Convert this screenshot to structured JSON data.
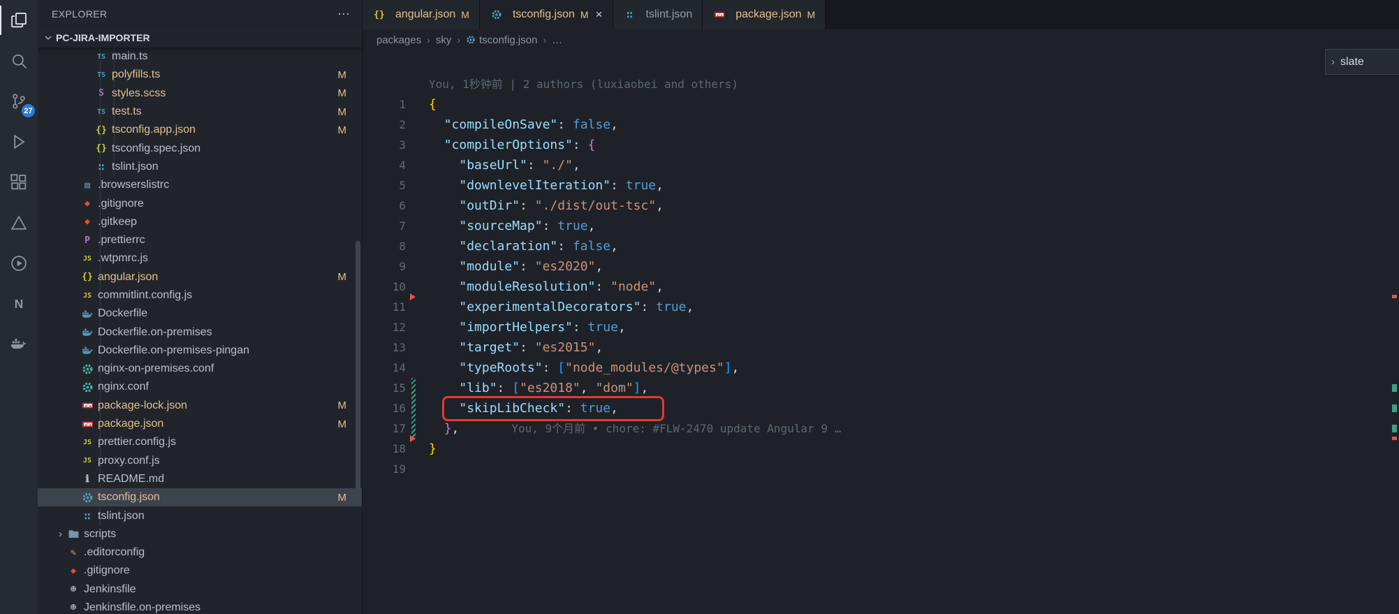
{
  "colors": {
    "git_modified": "#e2c08d",
    "annotation_red": "#e5392e",
    "badge_blue": "#2c7bd6",
    "modified_gutter": "#3ba183",
    "deleted_gutter": "#e5534b"
  },
  "activity_bar": {
    "items": [
      {
        "icon": "files-icon",
        "name": "explorer",
        "active": true
      },
      {
        "icon": "search-icon",
        "name": "search"
      },
      {
        "icon": "source-control-icon",
        "name": "source-control",
        "badge": "27"
      },
      {
        "icon": "run-debug-icon",
        "name": "run-debug"
      },
      {
        "icon": "extensions-icon",
        "name": "extensions"
      },
      {
        "icon": "triangle-extension-icon",
        "name": "triangle-extension"
      },
      {
        "icon": "play-circle-icon",
        "name": "play-circle-extension"
      },
      {
        "icon": "nx-icon",
        "name": "nx-console"
      },
      {
        "icon": "docker-icon",
        "name": "docker-extension"
      }
    ]
  },
  "sidebar": {
    "title": "EXPLORER",
    "more_label": "⋯",
    "section": "PC-JIRA-IMPORTER",
    "git_modified_label": "M",
    "tree": [
      {
        "label": "main.ts",
        "icon": "typescript",
        "level": 3
      },
      {
        "label": "polyfills.ts",
        "icon": "typescript",
        "level": 3,
        "modified": true
      },
      {
        "label": "styles.scss",
        "icon": "sass",
        "level": 3,
        "modified": true
      },
      {
        "label": "test.ts",
        "icon": "typescript",
        "level": 3,
        "modified": true
      },
      {
        "label": "tsconfig.app.json",
        "icon": "json",
        "level": 3,
        "modified": true
      },
      {
        "label": "tsconfig.spec.json",
        "icon": "json",
        "level": 3
      },
      {
        "label": "tslint.json",
        "icon": "tslint",
        "level": 3
      },
      {
        "label": ".browserslistrc",
        "icon": "browserslist",
        "level": 2
      },
      {
        "label": ".gitignore",
        "icon": "git",
        "level": 2
      },
      {
        "label": ".gitkeep",
        "icon": "git",
        "level": 2
      },
      {
        "label": ".prettierrc",
        "icon": "prettier",
        "level": 2
      },
      {
        "label": ".wtpmrc.js",
        "icon": "javascript",
        "level": 2
      },
      {
        "label": "angular.json",
        "icon": "json",
        "level": 2,
        "modified": true
      },
      {
        "label": "commitlint.config.js",
        "icon": "javascript",
        "level": 2
      },
      {
        "label": "Dockerfile",
        "icon": "docker",
        "level": 2
      },
      {
        "label": "Dockerfile.on-premises",
        "icon": "docker",
        "level": 2
      },
      {
        "label": "Dockerfile.on-premises-pingan",
        "icon": "docker",
        "level": 2
      },
      {
        "label": "nginx-on-premises.conf",
        "icon": "gear",
        "level": 2
      },
      {
        "label": "nginx.conf",
        "icon": "gear",
        "level": 2
      },
      {
        "label": "package-lock.json",
        "icon": "npm",
        "level": 2,
        "modified": true
      },
      {
        "label": "package.json",
        "icon": "npm",
        "level": 2,
        "modified": true
      },
      {
        "label": "prettier.config.js",
        "icon": "javascript",
        "level": 2
      },
      {
        "label": "proxy.conf.js",
        "icon": "javascript",
        "level": 2
      },
      {
        "label": "README.md",
        "icon": "readme",
        "level": 2
      },
      {
        "label": "tsconfig.json",
        "icon": "tsconfig",
        "level": 2,
        "modified": true,
        "selected": true
      },
      {
        "label": "tslint.json",
        "icon": "tslint",
        "level": 2
      },
      {
        "label": "scripts",
        "icon": "folder",
        "level": 1,
        "folder": true
      },
      {
        "label": ".editorconfig",
        "icon": "editorconfig",
        "level": 1
      },
      {
        "label": ".gitignore",
        "icon": "git",
        "level": 1
      },
      {
        "label": "Jenkinsfile",
        "icon": "jenkins",
        "level": 1
      },
      {
        "label": "Jenkinsfile.on-premises",
        "icon": "jenkins",
        "level": 1
      }
    ]
  },
  "tabs": [
    {
      "label": "angular.json",
      "icon": "json",
      "modified": "M",
      "active": false
    },
    {
      "label": "tsconfig.json",
      "icon": "tsconfig",
      "modified": "M",
      "active": true,
      "close": "×"
    },
    {
      "label": "tslint.json",
      "icon": "tslint",
      "active": false
    },
    {
      "label": "package.json",
      "icon": "npm",
      "modified": "M",
      "active": false
    }
  ],
  "breadcrumbs": {
    "separator": "›",
    "items": [
      {
        "label": "packages"
      },
      {
        "label": "sky"
      },
      {
        "label": "tsconfig.json",
        "icon": "tsconfig"
      },
      {
        "label": "…"
      }
    ]
  },
  "find_widget": {
    "chevron": "›",
    "text": "slate"
  },
  "editor": {
    "blame_top": "You, 1秒钟前 | 2 authors (luxiaobei and others)",
    "annotation": {
      "line": 16,
      "color": "#e5392e"
    },
    "gutter": {
      "modified_lines": [
        15,
        16,
        17
      ],
      "deleted_boundaries": [
        11,
        18
      ]
    },
    "lines": [
      {
        "n": 1,
        "tokens": [
          [
            "{",
            "b1"
          ]
        ]
      },
      {
        "n": 2,
        "tokens": [
          [
            "  ",
            ""
          ],
          [
            "\"compileOnSave\"",
            "key"
          ],
          [
            ":",
            "pun"
          ],
          [
            " ",
            ""
          ],
          [
            "false",
            "kw"
          ],
          [
            ",",
            "pun"
          ]
        ]
      },
      {
        "n": 3,
        "tokens": [
          [
            "  ",
            ""
          ],
          [
            "\"compilerOptions\"",
            "key"
          ],
          [
            ":",
            "pun"
          ],
          [
            " ",
            ""
          ],
          [
            "{",
            "b2"
          ]
        ]
      },
      {
        "n": 4,
        "tokens": [
          [
            "    ",
            ""
          ],
          [
            "\"baseUrl\"",
            "key"
          ],
          [
            ":",
            "pun"
          ],
          [
            " ",
            ""
          ],
          [
            "\"./\"",
            "str"
          ],
          [
            ",",
            "pun"
          ]
        ]
      },
      {
        "n": 5,
        "tokens": [
          [
            "    ",
            ""
          ],
          [
            "\"downlevelIteration\"",
            "key"
          ],
          [
            ":",
            "pun"
          ],
          [
            " ",
            ""
          ],
          [
            "true",
            "kw"
          ],
          [
            ",",
            "pun"
          ]
        ]
      },
      {
        "n": 6,
        "tokens": [
          [
            "    ",
            ""
          ],
          [
            "\"outDir\"",
            "key"
          ],
          [
            ":",
            "pun"
          ],
          [
            " ",
            ""
          ],
          [
            "\"./dist/out-tsc\"",
            "str"
          ],
          [
            ",",
            "pun"
          ]
        ]
      },
      {
        "n": 7,
        "tokens": [
          [
            "    ",
            ""
          ],
          [
            "\"sourceMap\"",
            "key"
          ],
          [
            ":",
            "pun"
          ],
          [
            " ",
            ""
          ],
          [
            "true",
            "kw"
          ],
          [
            ",",
            "pun"
          ]
        ]
      },
      {
        "n": 8,
        "tokens": [
          [
            "    ",
            ""
          ],
          [
            "\"declaration\"",
            "key"
          ],
          [
            ":",
            "pun"
          ],
          [
            " ",
            ""
          ],
          [
            "false",
            "kw"
          ],
          [
            ",",
            "pun"
          ]
        ]
      },
      {
        "n": 9,
        "tokens": [
          [
            "    ",
            ""
          ],
          [
            "\"module\"",
            "key"
          ],
          [
            ":",
            "pun"
          ],
          [
            " ",
            ""
          ],
          [
            "\"es2020\"",
            "str"
          ],
          [
            ",",
            "pun"
          ]
        ]
      },
      {
        "n": 10,
        "tokens": [
          [
            "    ",
            ""
          ],
          [
            "\"moduleResolution\"",
            "key"
          ],
          [
            ":",
            "pun"
          ],
          [
            " ",
            ""
          ],
          [
            "\"node\"",
            "str"
          ],
          [
            ",",
            "pun"
          ]
        ]
      },
      {
        "n": 11,
        "tokens": [
          [
            "    ",
            ""
          ],
          [
            "\"experimentalDecorators\"",
            "key"
          ],
          [
            ":",
            "pun"
          ],
          [
            " ",
            ""
          ],
          [
            "true",
            "kw"
          ],
          [
            ",",
            "pun"
          ]
        ]
      },
      {
        "n": 12,
        "tokens": [
          [
            "    ",
            ""
          ],
          [
            "\"importHelpers\"",
            "key"
          ],
          [
            ":",
            "pun"
          ],
          [
            " ",
            ""
          ],
          [
            "true",
            "kw"
          ],
          [
            ",",
            "pun"
          ]
        ]
      },
      {
        "n": 13,
        "tokens": [
          [
            "    ",
            ""
          ],
          [
            "\"target\"",
            "key"
          ],
          [
            ":",
            "pun"
          ],
          [
            " ",
            ""
          ],
          [
            "\"es2015\"",
            "str"
          ],
          [
            ",",
            "pun"
          ]
        ]
      },
      {
        "n": 14,
        "tokens": [
          [
            "    ",
            ""
          ],
          [
            "\"typeRoots\"",
            "key"
          ],
          [
            ":",
            "pun"
          ],
          [
            " ",
            ""
          ],
          [
            "[",
            "b3"
          ],
          [
            "\"node_modules/@types\"",
            "str"
          ],
          [
            "]",
            "b3"
          ],
          [
            ",",
            "pun"
          ]
        ]
      },
      {
        "n": 15,
        "tokens": [
          [
            "    ",
            ""
          ],
          [
            "\"lib\"",
            "key"
          ],
          [
            ":",
            "pun"
          ],
          [
            " ",
            ""
          ],
          [
            "[",
            "b3"
          ],
          [
            "\"es2018\"",
            "str"
          ],
          [
            ",",
            "pun"
          ],
          [
            " ",
            ""
          ],
          [
            "\"dom\"",
            "str"
          ],
          [
            "]",
            "b3"
          ],
          [
            ",",
            "pun"
          ]
        ]
      },
      {
        "n": 16,
        "tokens": [
          [
            "    ",
            ""
          ],
          [
            "\"skipLibCheck\"",
            "key"
          ],
          [
            ":",
            "pun"
          ],
          [
            " ",
            ""
          ],
          [
            "true",
            "kw"
          ],
          [
            ",",
            "pun"
          ]
        ]
      },
      {
        "n": 17,
        "tokens": [
          [
            "  ",
            ""
          ],
          [
            "}",
            "b2"
          ],
          [
            ",",
            "pun"
          ]
        ],
        "blame": "You, 9个月前 • chore: #FLW-2470 update Angular 9 …"
      },
      {
        "n": 18,
        "tokens": [
          [
            "}",
            "b1"
          ]
        ]
      },
      {
        "n": 19,
        "tokens": []
      }
    ]
  }
}
